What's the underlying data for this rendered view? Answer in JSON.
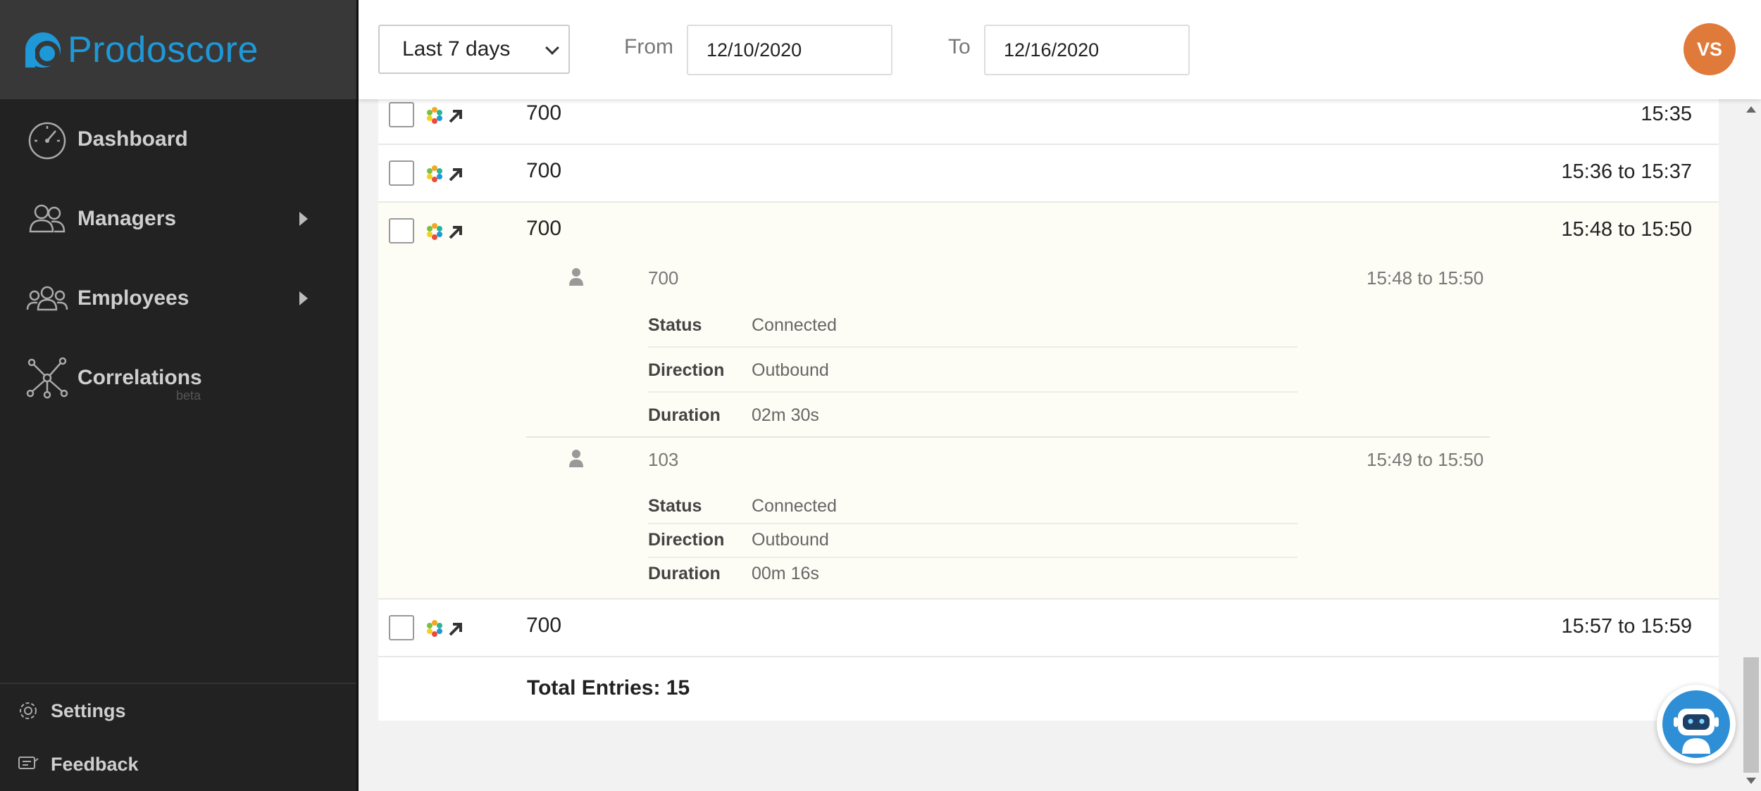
{
  "app": {
    "brand": "Prodoscore",
    "brand_color": "#1f98d8"
  },
  "sidebar": {
    "items": [
      {
        "label": "Dashboard",
        "icon": "speedometer-icon",
        "has_submenu": false
      },
      {
        "label": "Managers",
        "icon": "managers-icon",
        "has_submenu": true
      },
      {
        "label": "Employees",
        "icon": "employees-icon",
        "has_submenu": true
      },
      {
        "label": "Correlations",
        "icon": "network-icon",
        "has_submenu": false,
        "badge": "beta"
      }
    ],
    "bottom": [
      {
        "label": "Settings",
        "icon": "gear-icon"
      },
      {
        "label": "Feedback",
        "icon": "feedback-icon"
      }
    ]
  },
  "header": {
    "range": "Last 7 days",
    "from_label": "From",
    "from_value": "12/10/2020",
    "to_label": "To",
    "to_value": "12/16/2020",
    "avatar_initials": "VS",
    "avatar_color": "#e07a3b"
  },
  "calls": [
    {
      "number": "700",
      "time": "15:35"
    },
    {
      "number": "700",
      "time": "15:36 to 15:37"
    },
    {
      "number": "700",
      "time": "15:48 to 15:50",
      "participants": [
        {
          "number": "700",
          "time": "15:48 to 15:50",
          "details": [
            {
              "label": "Status",
              "value": "Connected"
            },
            {
              "label": "Direction",
              "value": "Outbound"
            },
            {
              "label": "Duration",
              "value": "02m 30s"
            }
          ]
        },
        {
          "number": "103",
          "time": "15:49 to 15:50",
          "details": [
            {
              "label": "Status",
              "value": "Connected"
            },
            {
              "label": "Direction",
              "value": "Outbound"
            },
            {
              "label": "Duration",
              "value": "00m 16s"
            }
          ]
        }
      ]
    },
    {
      "number": "700",
      "time": "15:57 to 15:59"
    }
  ],
  "footer": {
    "total": "Total Entries: 15"
  }
}
